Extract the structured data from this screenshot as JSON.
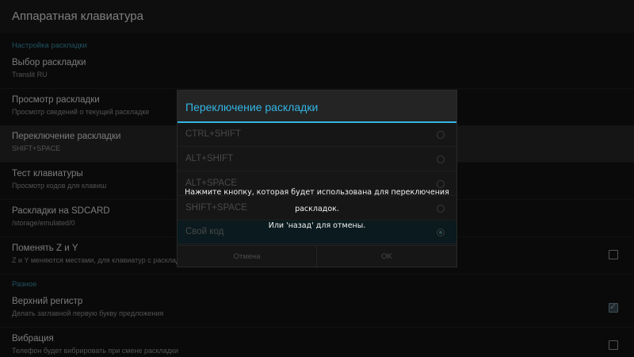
{
  "appbar": {
    "title": "Аппаратная клавиатура"
  },
  "sections": [
    {
      "header": "Настройка раскладки"
    },
    {
      "header": "Разное"
    }
  ],
  "prefs": [
    {
      "title": "Выбор раскладки",
      "summary": "Translit RU"
    },
    {
      "title": "Просмотр раскладки",
      "summary": "Просмотр сведений о текущей раскладке"
    },
    {
      "title": "Переключение раскладки",
      "summary": "SHIFT+SPACE"
    },
    {
      "title": "Тест клавиатуры",
      "summary": "Просмотр кодов для клавиш"
    },
    {
      "title": "Раскладки на SDCARD",
      "summary": "/storage/emulated/0"
    },
    {
      "title": "Поменять Z и Y",
      "summary": "Z и Y меняются местами, для клавиатур с расклад",
      "checked": false
    },
    {
      "title": "Верхний регистр",
      "summary": "Делать заглавной первую букву предложения",
      "checked": true
    },
    {
      "title": "Вибрация",
      "summary": "Телефон будет вибрировать при смене раскладки",
      "checked": false
    }
  ],
  "dialog": {
    "title": "Переключение раскладки",
    "options": [
      {
        "label": "CTRL+SHIFT",
        "selected": false
      },
      {
        "label": "ALT+SHIFT",
        "selected": false
      },
      {
        "label": "ALT+SPACE",
        "selected": false
      },
      {
        "label": "SHIFT+SPACE",
        "selected": false
      },
      {
        "label": "Свой код",
        "selected": true
      }
    ],
    "cancel_label": "Отмена",
    "ok_label": "OK"
  },
  "toast": {
    "line1": "Нажмите кнопку, которая будет использована для переключения раскладок.",
    "line2": "Или 'назад' для отмены."
  },
  "colors": {
    "accent": "#33b5e5",
    "section": "#3d9bb5",
    "background": "#141414"
  }
}
